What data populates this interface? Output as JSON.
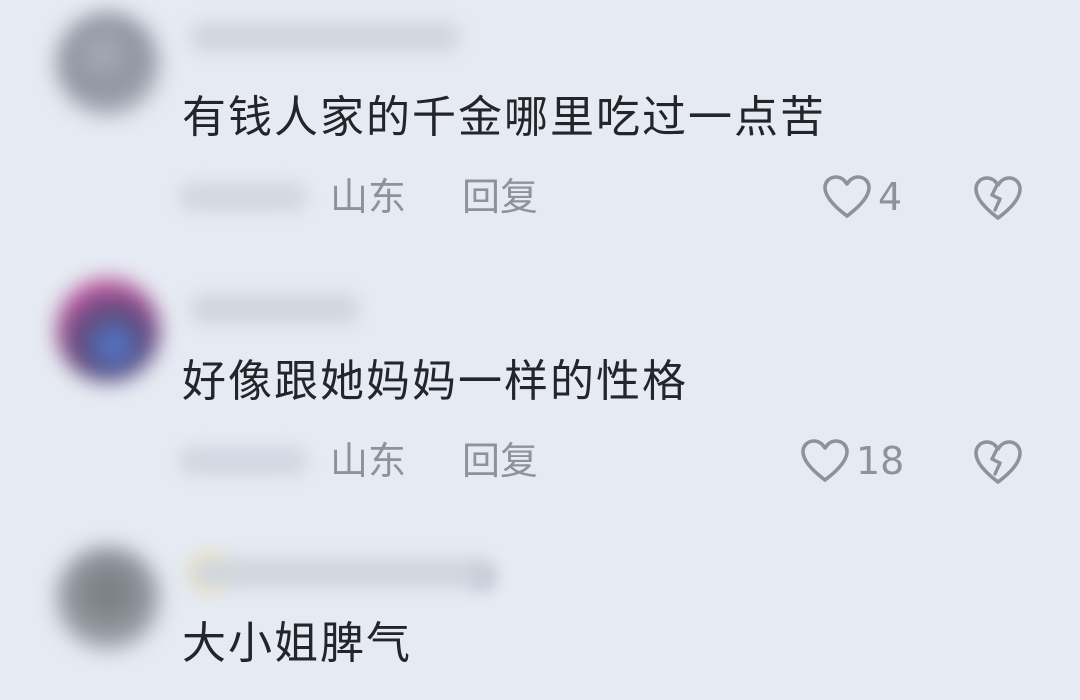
{
  "comments": [
    {
      "text": "有钱人家的千金哪里吃过一点苦",
      "location": "山东",
      "reply_label": "回复",
      "likes": "4"
    },
    {
      "text": "好像跟她妈妈一样的性格",
      "location": "山东",
      "reply_label": "回复",
      "likes": "18"
    },
    {
      "text": "大小姐脾气"
    }
  ],
  "icons": {
    "like": "heart-outline-icon",
    "dislike": "broken-heart-icon"
  },
  "colors": {
    "background": "#e6ebf3",
    "text": "#23252b",
    "meta": "#8d939c"
  }
}
